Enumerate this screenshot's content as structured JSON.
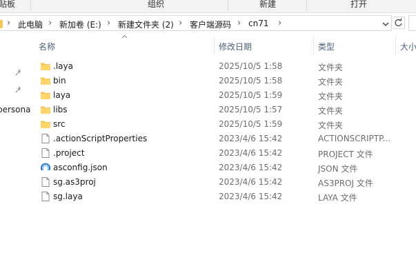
{
  "ribbon": {
    "clipboard": "贴板",
    "organize": "组织",
    "new": "新建",
    "open": "打开"
  },
  "address": {
    "crumbs": [
      "此电脑",
      "新加卷 (E:)",
      "新建文件夹 (2)",
      "客户端源码",
      "cn71"
    ]
  },
  "navpane": {
    "partial_label": "persona"
  },
  "columns": {
    "name": "名称",
    "modified": "修改日期",
    "type": "类型",
    "size": "大小"
  },
  "files": [
    {
      "name": ".laya",
      "date": "2025/10/5 1:58",
      "type": "文件夹",
      "icon": "folder-icon"
    },
    {
      "name": "bin",
      "date": "2025/10/5 1:58",
      "type": "文件夹",
      "icon": "folder-icon"
    },
    {
      "name": "laya",
      "date": "2025/10/5 1:59",
      "type": "文件夹",
      "icon": "folder-icon"
    },
    {
      "name": "libs",
      "date": "2025/10/5 1:57",
      "type": "文件夹",
      "icon": "folder-icon"
    },
    {
      "name": "src",
      "date": "2025/10/5 1:59",
      "type": "文件夹",
      "icon": "folder-icon"
    },
    {
      "name": ".actionScriptProperties",
      "date": "2023/4/6 15:42",
      "type": "ACTIONSCRIPTP...",
      "icon": "file-icon"
    },
    {
      "name": ".project",
      "date": "2023/4/6 15:42",
      "type": "PROJECT 文件",
      "icon": "file-icon"
    },
    {
      "name": "asconfig.json",
      "date": "2023/4/6 15:42",
      "type": "JSON 文件",
      "icon": "json-file-icon"
    },
    {
      "name": "sg.as3proj",
      "date": "2023/4/6 15:42",
      "type": "AS3PROJ 文件",
      "icon": "file-icon"
    },
    {
      "name": "sg.laya",
      "date": "2023/4/6 15:42",
      "type": "LAYA 文件",
      "icon": "file-icon"
    }
  ]
}
